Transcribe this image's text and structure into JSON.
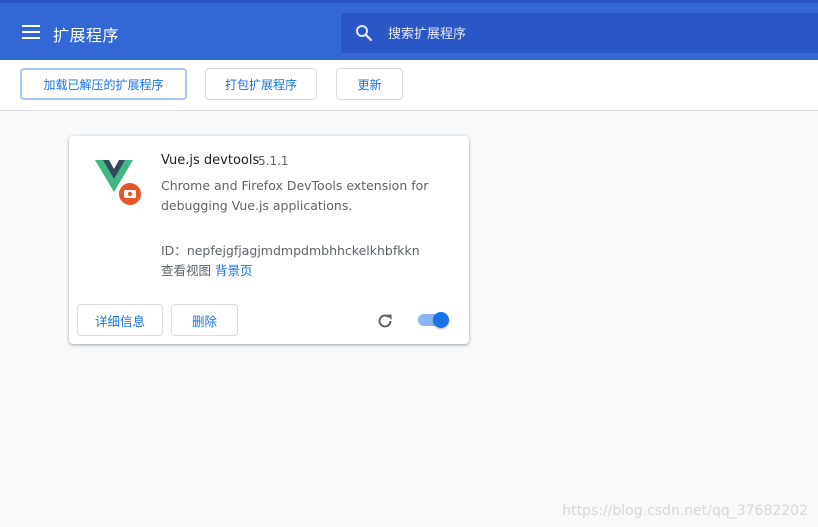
{
  "header": {
    "title": "扩展程序",
    "menu_icon": "hamburger-menu-icon",
    "search": {
      "placeholder": "搜索扩展程序",
      "value": "",
      "icon": "search-icon"
    }
  },
  "toolbar": {
    "load_unpacked_label": "加载已解压的扩展程序",
    "pack_label": "打包扩展程序",
    "update_label": "更新"
  },
  "extension": {
    "name": "Vue.js devtools",
    "version": "5.1.1",
    "description": "Chrome and Firefox DevTools extension for debugging Vue.js applications.",
    "id_label": "ID：",
    "id": "nepfejgfjagjmdmpdmbhhckelkhbfkkn",
    "inspect_views_label": "查看视图",
    "background_page_link": "背景页",
    "details_label": "详细信息",
    "remove_label": "删除",
    "enabled": true,
    "icon": "vue-devtools-logo-icon"
  },
  "watermark": "https://blog.csdn.net/qq_37682202",
  "colors": {
    "header_bg": "#3367d6",
    "search_bg": "#2a56c6",
    "accent": "#1a73e8",
    "vue_green": "#41b883",
    "vue_dark": "#34495e",
    "badge_orange": "#e8572a"
  }
}
